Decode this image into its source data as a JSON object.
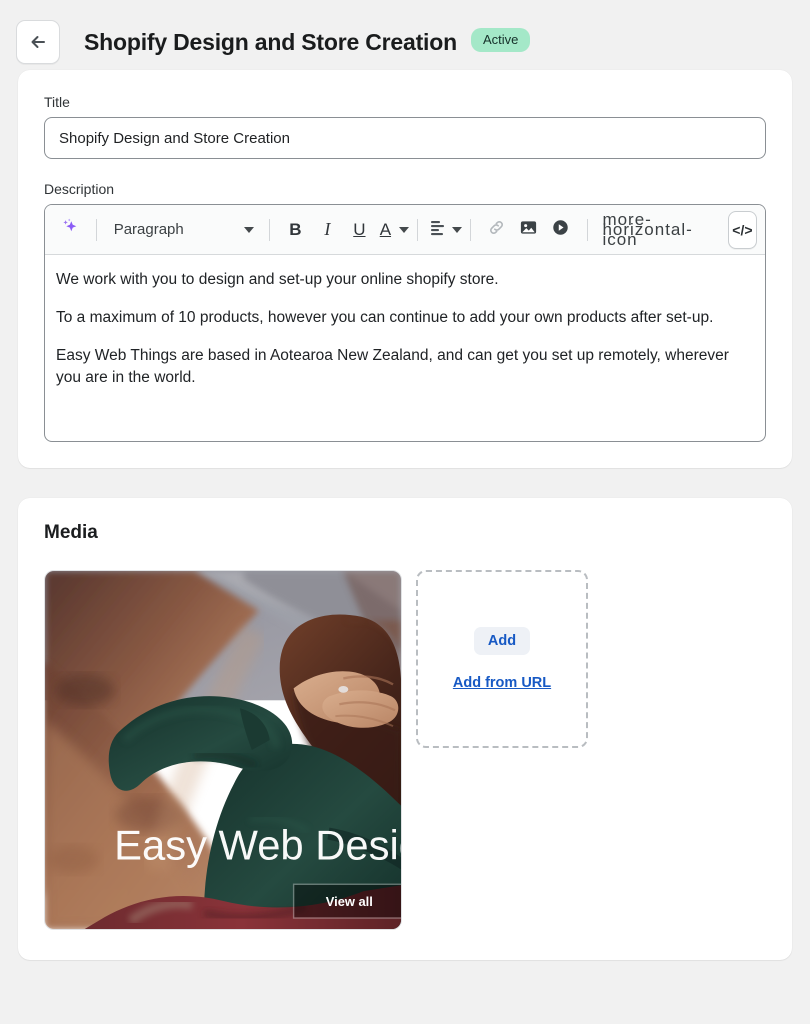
{
  "header": {
    "back_icon": "arrow-left-icon",
    "title": "Shopify Design and Store Creation",
    "status_badge": "Active"
  },
  "details_card": {
    "title_label": "Title",
    "title_value": "Shopify Design and Store Creation",
    "title_placeholder": "Title",
    "description_label": "Description",
    "toolbar": {
      "ai_icon": "sparkle-icon",
      "block_format": "Paragraph",
      "bold": "B",
      "italic": "I",
      "underline": "U",
      "text_color": "A",
      "align_icon": "align-left-icon",
      "link_icon": "link-icon",
      "image_icon": "image-icon",
      "video_icon": "video-play-icon",
      "more_icon": "more-horizontal-icon",
      "code_icon": "</>"
    },
    "description_paragraphs": [
      "We work with you to design and set-up your online shopify store.",
      "To a maximum of 10 products, however you can continue to add your own products after set-up.",
      "Easy Web Things are based in Aotearoa New Zealand, and can get you set up remotely, wherever you are in the world."
    ]
  },
  "media_card": {
    "heading": "Media",
    "thumbnail": {
      "overlay_title": "Easy Web Design",
      "overlay_button": "View all",
      "colors": {
        "rock_dark": "#5a3a31",
        "rock_mid": "#8d5f4a",
        "rock_light": "#b78366",
        "mountain": "#84858f",
        "sky": "#9a9ba6",
        "jacket_green": "#1f3a33",
        "jacket_maroon": "#7a2f33",
        "hair": "#4a2a22",
        "skin": "#c79a7e"
      }
    },
    "dropzone": {
      "add_label": "Add",
      "add_from_url_label": "Add from URL"
    }
  },
  "theme": {
    "page_background": "#f1f1f1",
    "card_background": "#ffffff",
    "accent_link": "#1759c4",
    "badge_background": "#a4e8c8",
    "sparkle_purple": "#8b5cf6"
  }
}
